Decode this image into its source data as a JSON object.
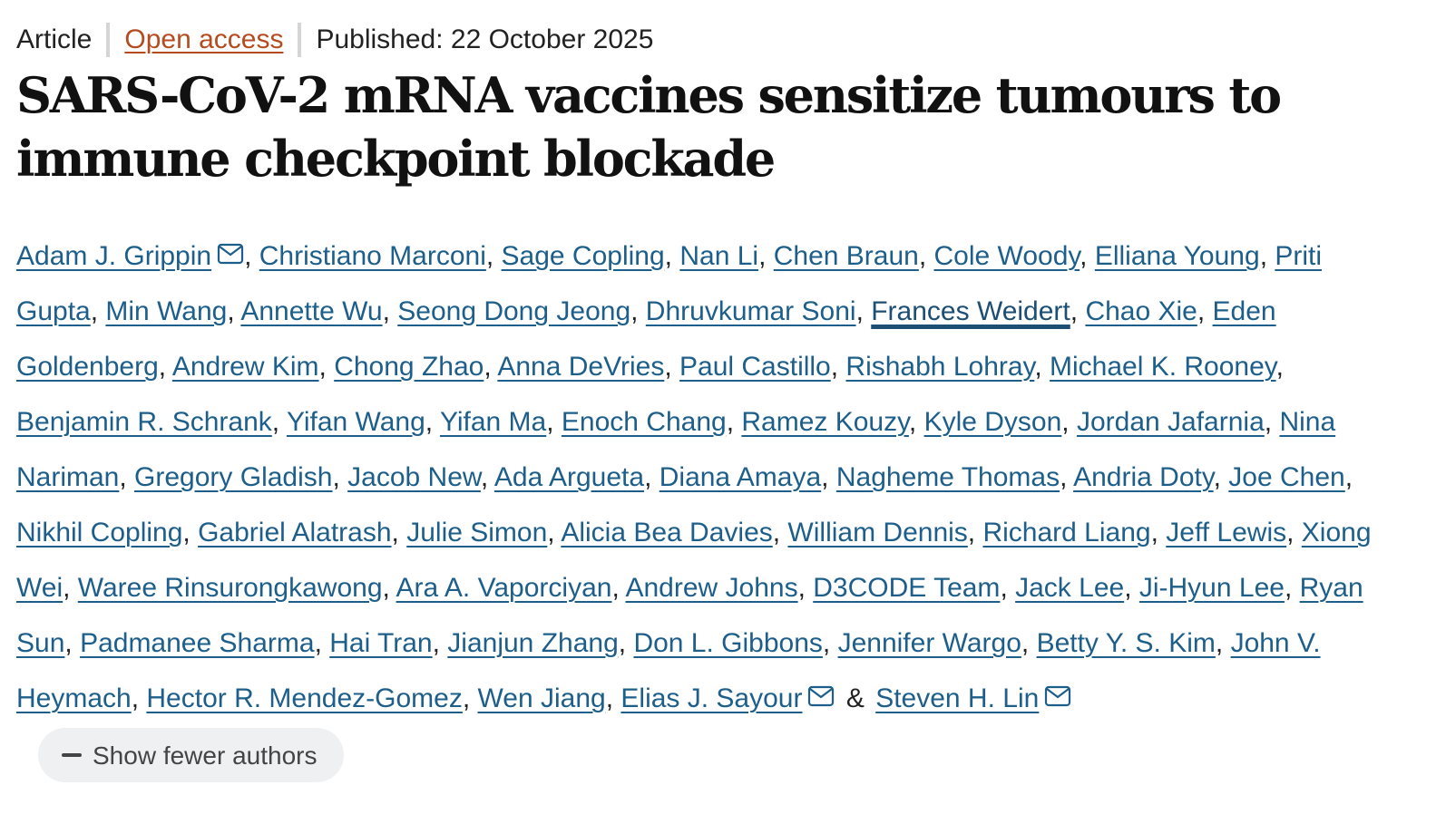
{
  "meta": {
    "type": "Article",
    "access": "Open access",
    "published": "Published: 22 October 2025"
  },
  "title": "SARS-CoV-2 mRNA vaccines sensitize tumours to immune checkpoint blockade",
  "authors": [
    {
      "name": "Adam J. Grippin",
      "email": true
    },
    {
      "name": "Christiano Marconi"
    },
    {
      "name": "Sage Copling"
    },
    {
      "name": "Nan Li"
    },
    {
      "name": "Chen Braun"
    },
    {
      "name": "Cole Woody"
    },
    {
      "name": "Elliana Young"
    },
    {
      "name": "Priti Gupta"
    },
    {
      "name": "Min Wang"
    },
    {
      "name": "Annette Wu"
    },
    {
      "name": "Seong Dong Jeong"
    },
    {
      "name": "Dhruvkumar Soni"
    },
    {
      "name": "Frances Weidert",
      "hovered": true
    },
    {
      "name": "Chao Xie"
    },
    {
      "name": "Eden Goldenberg"
    },
    {
      "name": "Andrew Kim"
    },
    {
      "name": "Chong Zhao"
    },
    {
      "name": "Anna DeVries"
    },
    {
      "name": "Paul Castillo"
    },
    {
      "name": "Rishabh Lohray"
    },
    {
      "name": "Michael K. Rooney"
    },
    {
      "name": "Benjamin R. Schrank"
    },
    {
      "name": "Yifan Wang"
    },
    {
      "name": "Yifan Ma"
    },
    {
      "name": "Enoch Chang"
    },
    {
      "name": "Ramez Kouzy"
    },
    {
      "name": "Kyle Dyson"
    },
    {
      "name": "Jordan Jafarnia"
    },
    {
      "name": "Nina Nariman"
    },
    {
      "name": "Gregory Gladish"
    },
    {
      "name": "Jacob New"
    },
    {
      "name": "Ada Argueta"
    },
    {
      "name": "Diana Amaya"
    },
    {
      "name": "Nagheme Thomas"
    },
    {
      "name": "Andria Doty"
    },
    {
      "name": "Joe Chen"
    },
    {
      "name": "Nikhil Copling"
    },
    {
      "name": "Gabriel Alatrash"
    },
    {
      "name": "Julie Simon"
    },
    {
      "name": "Alicia Bea Davies"
    },
    {
      "name": "William Dennis"
    },
    {
      "name": "Richard Liang"
    },
    {
      "name": "Jeff Lewis"
    },
    {
      "name": "Xiong Wei"
    },
    {
      "name": "Waree Rinsurongkawong"
    },
    {
      "name": "Ara A. Vaporciyan"
    },
    {
      "name": "Andrew Johns"
    },
    {
      "name": "D3CODE Team"
    },
    {
      "name": "Jack Lee"
    },
    {
      "name": "Ji-Hyun Lee"
    },
    {
      "name": "Ryan Sun"
    },
    {
      "name": "Padmanee Sharma"
    },
    {
      "name": "Hai Tran"
    },
    {
      "name": "Jianjun Zhang"
    },
    {
      "name": "Don L. Gibbons"
    },
    {
      "name": "Jennifer Wargo"
    },
    {
      "name": "Betty Y. S. Kim"
    },
    {
      "name": "John V. Heymach"
    },
    {
      "name": "Hector R. Mendez-Gomez"
    },
    {
      "name": "Wen Jiang"
    },
    {
      "name": "Elias J. Sayour",
      "email": true
    },
    {
      "name": "Steven H. Lin",
      "email": true
    }
  ],
  "ampersand": "&",
  "toggle_label": "Show fewer authors",
  "icons": {
    "email": "envelope-icon",
    "toggle": "minus-icon"
  },
  "colors": {
    "link": "#1d5f8a",
    "open_access": "#b44c1f"
  }
}
